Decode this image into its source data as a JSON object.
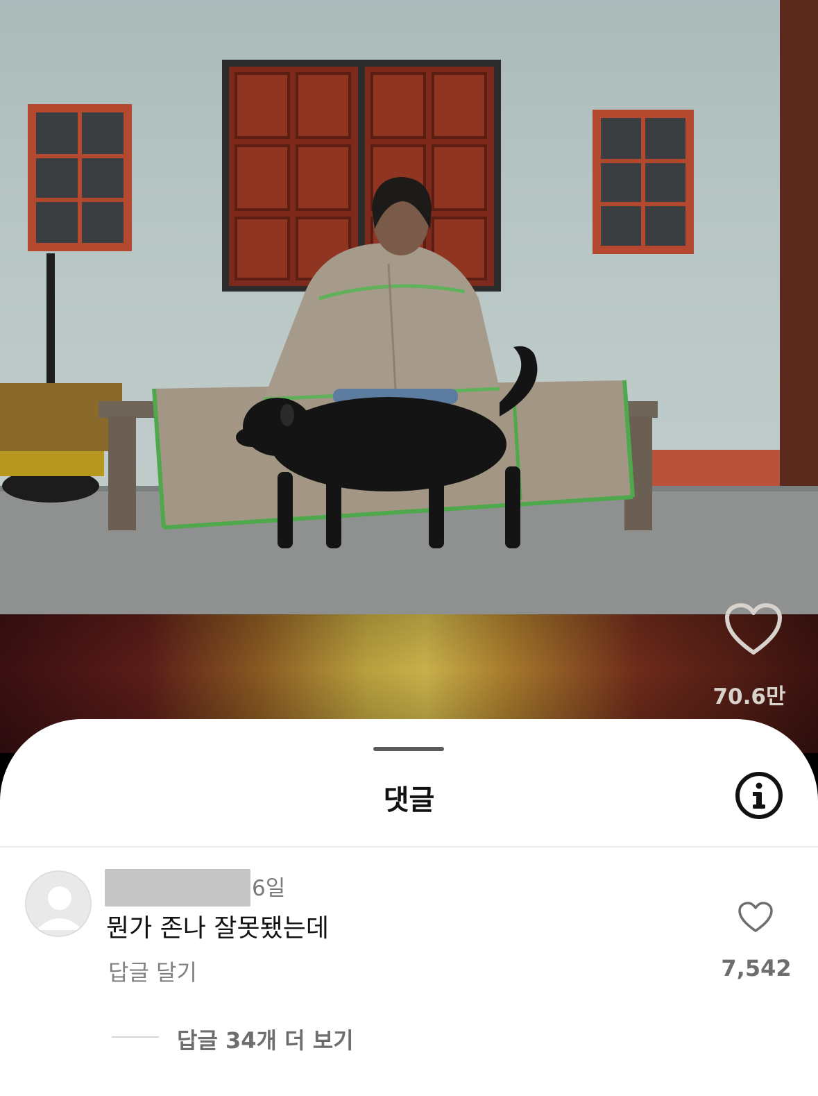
{
  "video": {
    "like_count": "70.6만",
    "icons": {
      "like": "heart-outline-icon"
    }
  },
  "comments_sheet": {
    "title": "댓글",
    "icons": {
      "info": "info-circle-icon"
    },
    "comments": [
      {
        "author_redacted": true,
        "time": "6일",
        "text": "뭔가 존나 잘못됐는데",
        "reply_label": "답글 달기",
        "like_count": "7,542",
        "more_replies_label": "답글 34개 더 보기"
      }
    ]
  },
  "colors": {
    "sheet_bg": "#ffffff",
    "secondary_text": "#7a7a7a",
    "primary_text": "#111111"
  }
}
